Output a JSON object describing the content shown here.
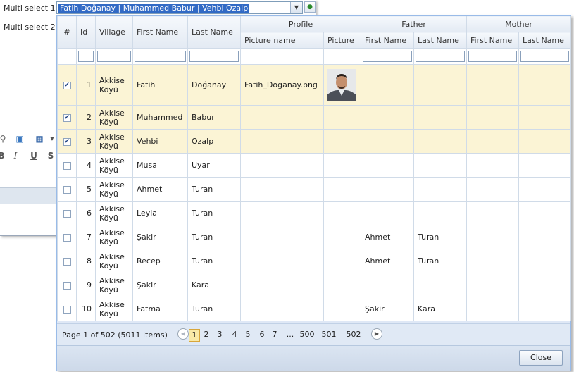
{
  "form": {
    "multi_select_1_label": "Multi select 1",
    "multi_select_2_label": "Multi select 2",
    "toolbar_icons": [
      "find-replace-icon",
      "image-icon",
      "table-icon",
      "dropdown-arrow-icon"
    ],
    "format_buttons": {
      "italic": "I",
      "underline": "U",
      "strike": "S"
    }
  },
  "combo": {
    "value": "Fatih Doğanay | Muhammed Babur | Vehbi Özalp",
    "arrow_icon": "chevron-down-icon",
    "action_icon": "refresh-icon"
  },
  "grid": {
    "headers": {
      "check": "#",
      "id": "Id",
      "village": "Village",
      "first_name": "First Name",
      "last_name": "Last Name",
      "profile": "Profile",
      "picture_name": "Picture name",
      "picture": "Picture",
      "father": "Father",
      "father_first": "First Name",
      "father_last": "Last Name",
      "mother": "Mother",
      "mother_first": "First Name",
      "mother_last": "Last Name"
    },
    "rows": [
      {
        "checked": true,
        "id": "1",
        "village": "Akkise Köyü",
        "first": "Fatih",
        "last": "Doğanay",
        "picture_name": "Fatih_Doganay.png",
        "has_picture": true,
        "father_first": "",
        "father_last": "",
        "mother_first": "",
        "mother_last": ""
      },
      {
        "checked": true,
        "id": "2",
        "village": "Akkise Köyü",
        "first": "Muhammed",
        "last": "Babur",
        "picture_name": "",
        "has_picture": false,
        "father_first": "",
        "father_last": "",
        "mother_first": "",
        "mother_last": ""
      },
      {
        "checked": true,
        "id": "3",
        "village": "Akkise Köyü",
        "first": "Vehbi",
        "last": "Özalp",
        "picture_name": "",
        "has_picture": false,
        "father_first": "",
        "father_last": "",
        "mother_first": "",
        "mother_last": ""
      },
      {
        "checked": false,
        "id": "4",
        "village": "Akkise Köyü",
        "first": "Musa",
        "last": "Uyar",
        "picture_name": "",
        "has_picture": false,
        "father_first": "",
        "father_last": "",
        "mother_first": "",
        "mother_last": ""
      },
      {
        "checked": false,
        "id": "5",
        "village": "Akkise Köyü",
        "first": "Ahmet",
        "last": "Turan",
        "picture_name": "",
        "has_picture": false,
        "father_first": "",
        "father_last": "",
        "mother_first": "",
        "mother_last": ""
      },
      {
        "checked": false,
        "id": "6",
        "village": "Akkise Köyü",
        "first": "Leyla",
        "last": "Turan",
        "picture_name": "",
        "has_picture": false,
        "father_first": "",
        "father_last": "",
        "mother_first": "",
        "mother_last": ""
      },
      {
        "checked": false,
        "id": "7",
        "village": "Akkise Köyü",
        "first": "Şakir",
        "last": "Turan",
        "picture_name": "",
        "has_picture": false,
        "father_first": "Ahmet",
        "father_last": "Turan",
        "mother_first": "",
        "mother_last": ""
      },
      {
        "checked": false,
        "id": "8",
        "village": "Akkise Köyü",
        "first": "Recep",
        "last": "Turan",
        "picture_name": "",
        "has_picture": false,
        "father_first": "Ahmet",
        "father_last": "Turan",
        "mother_first": "",
        "mother_last": ""
      },
      {
        "checked": false,
        "id": "9",
        "village": "Akkise Köyü",
        "first": "Şakir",
        "last": "Kara",
        "picture_name": "",
        "has_picture": false,
        "father_first": "",
        "father_last": "",
        "mother_first": "",
        "mother_last": ""
      },
      {
        "checked": false,
        "id": "10",
        "village": "Akkise Köyü",
        "first": "Fatma",
        "last": "Turan",
        "picture_name": "",
        "has_picture": false,
        "father_first": "Şakir",
        "father_last": "Kara",
        "mother_first": "",
        "mother_last": ""
      }
    ]
  },
  "pager": {
    "info": "Page 1 of 502 (5011 items)",
    "pages": [
      "1",
      "2",
      "3",
      "4",
      "5",
      "6",
      "7",
      "...",
      "500",
      "501",
      "502"
    ],
    "current": "1",
    "prev_icon": "chevron-left-icon",
    "next_icon": "chevron-right-icon"
  },
  "footer": {
    "close_label": "Close"
  },
  "colors": {
    "selected_row": "#fbf4d5",
    "header_bg": "#e3eaf3",
    "panel_bg": "#dfe8f6",
    "combo_selection": "#316ac5",
    "current_page": "#f9e9a6"
  }
}
